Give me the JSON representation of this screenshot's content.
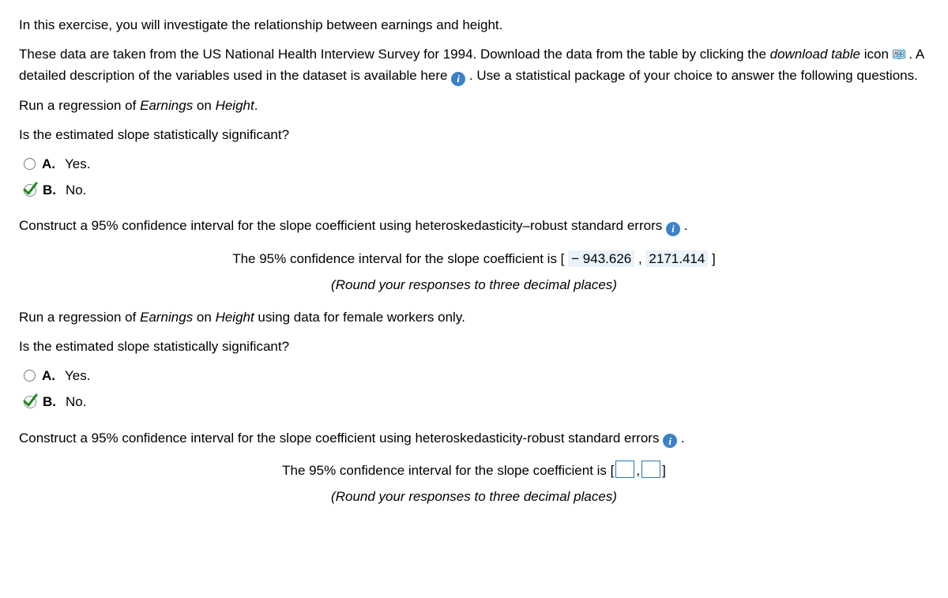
{
  "intro": {
    "p1": "In this exercise, you will investigate the relationship between earnings and height.",
    "p2a": "These data are taken from the US National Health Interview Survey for 1994. Download the data from the table by clicking the ",
    "p2_it": "download table",
    "p2b": " icon ",
    "p2c": " . A detailed description of the variables used in the dataset is available here ",
    "p2d": " . Use a statistical package of your choice to answer the following questions."
  },
  "q1": {
    "line1a": "Run a regression of ",
    "line1_it1": "Earnings",
    "line1b": " on ",
    "line1_it2": "Height",
    "line1c": ".",
    "line2": "Is the estimated slope statistically significant?",
    "optA_letter": "A.",
    "optA_text": "Yes.",
    "optB_letter": "B.",
    "optB_text": "No."
  },
  "ci1": {
    "prompt_a": "Construct a 95% confidence interval for the slope coefficient using heteroskedasticity–robust standard errors ",
    "prompt_b": " .",
    "ans_label": "The 95% confidence interval for the slope coefficient is [ ",
    "lower": "− 943.626",
    "sep": " , ",
    "upper": "2171.414",
    "close": " ]",
    "hint": "(Round your responses to three decimal places)"
  },
  "q2": {
    "line1a": "Run a regression of ",
    "line1_it1": "Earnings",
    "line1b": " on ",
    "line1_it2": "Height",
    "line1c": " using data for female workers only.",
    "line2": "Is the estimated slope statistically significant?",
    "optA_letter": "A.",
    "optA_text": "Yes.",
    "optB_letter": "B.",
    "optB_text": "No."
  },
  "ci2": {
    "prompt_a": "Construct a 95% confidence interval for the slope coefficient using heteroskedasticity-robust standard errors ",
    "prompt_b": " .",
    "ans_label": "The 95% confidence interval for the slope coefficient is [",
    "sep": ",",
    "close": "]",
    "hint": "(Round your responses to three decimal places)"
  }
}
